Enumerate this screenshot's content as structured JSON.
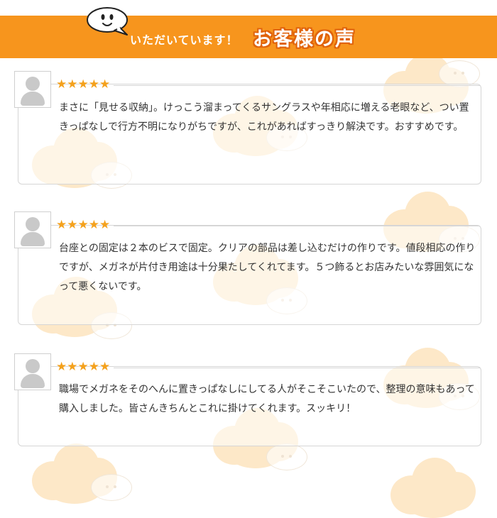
{
  "header": {
    "subtitle": "いただいています！",
    "title": "お客様の声",
    "color": "#f7951d"
  },
  "reviews": [
    {
      "stars": "★★★★★",
      "rating": 5,
      "text": "まさに「見せる収納」。けっこう溜まってくるサングラスや年相応に増える老眼など、つい置きっぱなしで行方不明になりがちですが、これがあればすっきり解決です。おすすめです。"
    },
    {
      "stars": "★★★★★",
      "rating": 5,
      "text": "台座との固定は２本のビスで固定。クリアの部品は差し込むだけの作りです。値段相応の作りですが、メガネが片付き用途は十分果たしてくれてます。５つ飾るとお店みたいな雰囲気になって悪くないです。"
    },
    {
      "stars": "★★★★★",
      "rating": 5,
      "text": "職場でメガネをそのへんに置きっぱなしにしてる人がそこそこいたので、整理の意味もあって購入しました。皆さんきちんとこれに掛けてくれます。スッキリ！"
    }
  ],
  "colors": {
    "star": "#f4a11c",
    "card_border": "#d6d6d6"
  }
}
